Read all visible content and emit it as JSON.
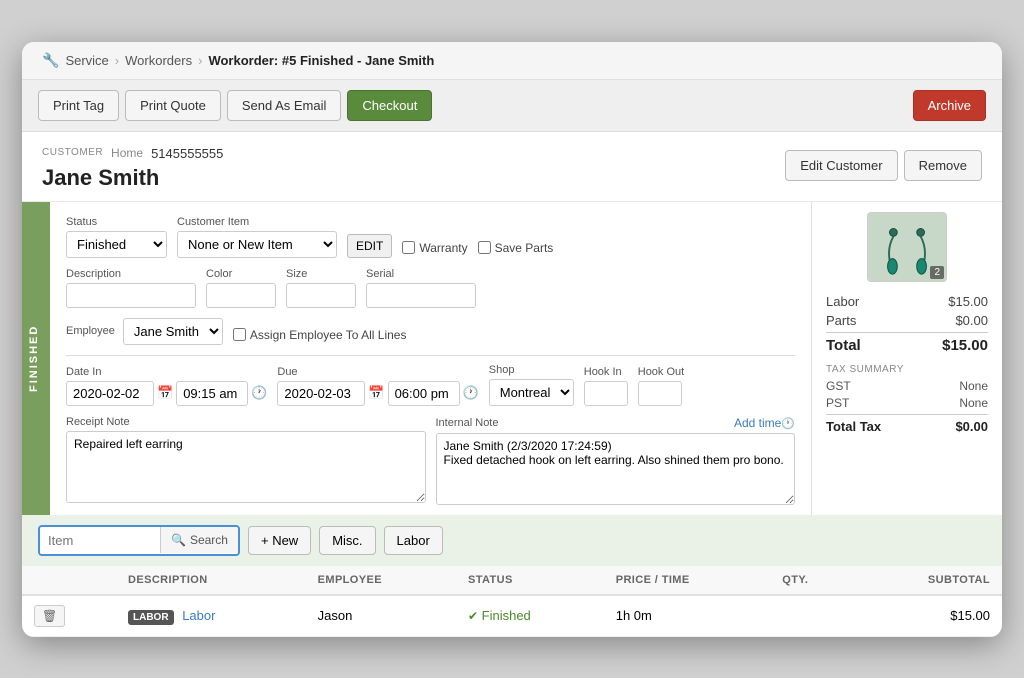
{
  "breadcrumb": {
    "service": "Service",
    "workorders": "Workorders",
    "current": "Workorder: #5 Finished - Jane Smith"
  },
  "toolbar": {
    "print_tag": "Print Tag",
    "print_quote": "Print Quote",
    "send_as_email": "Send As Email",
    "checkout": "Checkout",
    "archive": "Archive"
  },
  "customer": {
    "section_label": "CUSTOMER",
    "name": "Jane Smith",
    "phone_type": "Home",
    "phone": "5145555555",
    "edit_btn": "Edit Customer",
    "remove_btn": "Remove"
  },
  "workorder": {
    "finished_tab": "FINISHED",
    "status_label": "Status",
    "status_value": "Finished",
    "customer_item_label": "Customer Item",
    "customer_item_value": "None or New Item",
    "edit_btn": "EDIT",
    "warranty_label": "Warranty",
    "save_parts_label": "Save Parts",
    "description_label": "Description",
    "color_label": "Color",
    "size_label": "Size",
    "serial_label": "Serial",
    "employee_label": "Employee",
    "employee_value": "Jane Smith",
    "assign_all_label": "Assign Employee To All Lines",
    "date_in_label": "Date In",
    "date_in_value": "2020-02-02",
    "time_in_value": "09:15 am",
    "due_label": "Due",
    "due_value": "2020-02-03",
    "time_due_value": "06:00 pm",
    "shop_label": "Shop",
    "shop_value": "Montreal",
    "hook_in_label": "Hook In",
    "hook_out_label": "Hook Out",
    "receipt_note_label": "Receipt Note",
    "receipt_note_value": "Repaired left earring",
    "internal_note_label": "Internal Note",
    "add_time_label": "Add time",
    "internal_note_value": "Jane Smith (2/3/2020 17:24:59)\nFixed detached hook on left earring. Also shined them pro bono."
  },
  "pricing": {
    "labor_label": "Labor",
    "labor_value": "$15.00",
    "parts_label": "Parts",
    "parts_value": "$0.00",
    "total_label": "Total",
    "total_value": "$15.00",
    "tax_summary_label": "TAX SUMMARY",
    "gst_label": "GST",
    "gst_value": "None",
    "pst_label": "PST",
    "pst_value": "None",
    "total_tax_label": "Total Tax",
    "total_tax_value": "$0.00"
  },
  "items_bar": {
    "search_placeholder": "Item",
    "search_btn": "Search",
    "new_btn": "+ New",
    "misc_btn": "Misc.",
    "labor_btn": "Labor"
  },
  "table": {
    "headers": [
      "",
      "DESCRIPTION",
      "EMPLOYEE",
      "STATUS",
      "PRICE / TIME",
      "QTY.",
      "SUBTOTAL"
    ],
    "rows": [
      {
        "badge": "LABOR",
        "description": "Labor",
        "employee": "Jason",
        "status": "Finished",
        "price_time": "1h 0m",
        "qty": "",
        "subtotal": "$15.00"
      }
    ]
  }
}
